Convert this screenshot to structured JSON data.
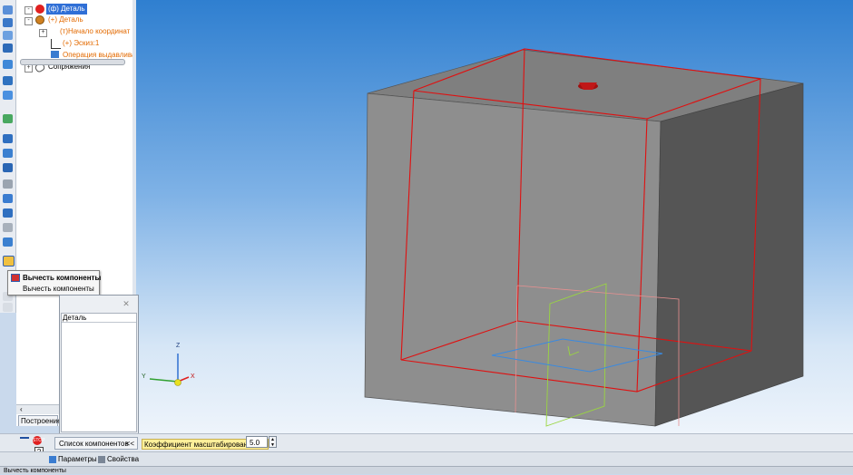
{
  "tree": {
    "items": [
      {
        "label": "(ф) Деталь",
        "selected": true,
        "color": "#ffffff"
      },
      {
        "label": "(+) Деталь",
        "color": "#e36a00"
      },
      {
        "label": "(т)Начало координат",
        "color": "#e36a00"
      },
      {
        "label": "(+) Эскиз:1",
        "color": "#e36a00"
      },
      {
        "label": "Операция выдавлива",
        "color": "#e36a00"
      },
      {
        "label": "Сопряжения",
        "color": "#000000"
      }
    ],
    "build_tab": "Построение"
  },
  "tooltip": {
    "title": "Вычесть компоненты",
    "description": "Вычесть компоненты"
  },
  "components_panel": {
    "close_glyph": "✕",
    "column_header": "Деталь",
    "tab_label": "Список компонентов",
    "collapse_glyph": "<<"
  },
  "parameters": {
    "scale_label": "Коэффициент масштабирования, %",
    "scale_value": "5.0"
  },
  "tabs": {
    "parameters": "Параметры",
    "properties": "Свойства"
  },
  "status": {
    "text": "Вычесть компоненты"
  },
  "axes": {
    "x": "X",
    "y": "Y",
    "z": "Z"
  },
  "colors": {
    "accent_red": "#e01010",
    "tree_orange": "#e36a00",
    "selection_blue": "#3070d0",
    "model_gray": "#8c8c8c"
  },
  "icons": {
    "stop": "stop-icon",
    "help": "help-icon",
    "pin": "pin-icon"
  }
}
